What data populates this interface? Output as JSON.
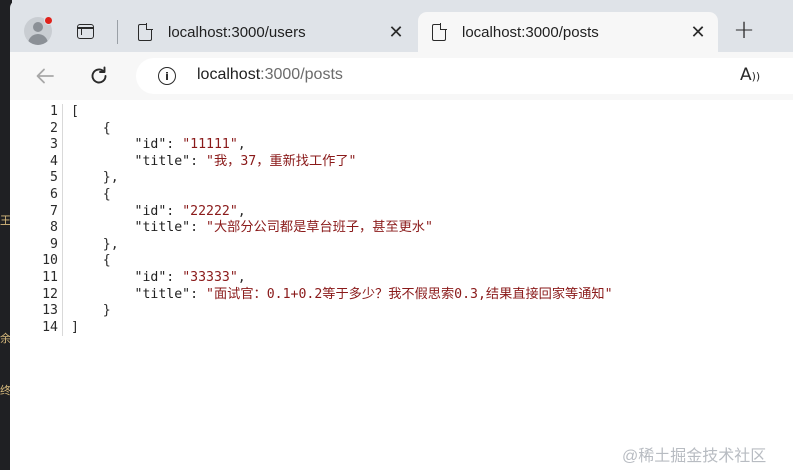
{
  "background_editor": {
    "marks": [
      "王",
      "余",
      "终"
    ]
  },
  "tabs": [
    {
      "title": "localhost:3000/users",
      "active": false
    },
    {
      "title": "localhost:3000/posts",
      "active": true
    }
  ],
  "new_tab_label": "+",
  "address_bar": {
    "host": "localhost",
    "path": ":3000/posts"
  },
  "json_viewer": {
    "lines": [
      {
        "n": "1",
        "indent": "",
        "text": "["
      },
      {
        "n": "2",
        "indent": "    ",
        "text": "{"
      },
      {
        "n": "3",
        "indent": "        ",
        "key": "\"id\"",
        "value": "\"11111\"",
        "trail": ","
      },
      {
        "n": "4",
        "indent": "        ",
        "key": "\"title\"",
        "value": "\"我，37，重新找工作了\""
      },
      {
        "n": "5",
        "indent": "    ",
        "text": "},"
      },
      {
        "n": "6",
        "indent": "    ",
        "text": "{"
      },
      {
        "n": "7",
        "indent": "        ",
        "key": "\"id\"",
        "value": "\"22222\"",
        "trail": ","
      },
      {
        "n": "8",
        "indent": "        ",
        "key": "\"title\"",
        "value": "\"大部分公司都是草台班子，甚至更水\""
      },
      {
        "n": "9",
        "indent": "    ",
        "text": "},"
      },
      {
        "n": "10",
        "indent": "    ",
        "text": "{"
      },
      {
        "n": "11",
        "indent": "        ",
        "key": "\"id\"",
        "value": "\"33333\"",
        "trail": ","
      },
      {
        "n": "12",
        "indent": "        ",
        "key": "\"title\"",
        "value": "\"面试官：0.1+0.2等于多少？我不假思索0.3,结果直接回家等通知\""
      },
      {
        "n": "13",
        "indent": "    ",
        "text": "}"
      },
      {
        "n": "14",
        "indent": "",
        "text": "]"
      }
    ]
  },
  "watermark": "@稀土掘金技术社区",
  "colors": {
    "string": "#8a1a1a",
    "tab_active_bg": "#f7f7f7",
    "tab_strip_bg": "#dfe3e8",
    "profile_badge": "#e0221b"
  }
}
